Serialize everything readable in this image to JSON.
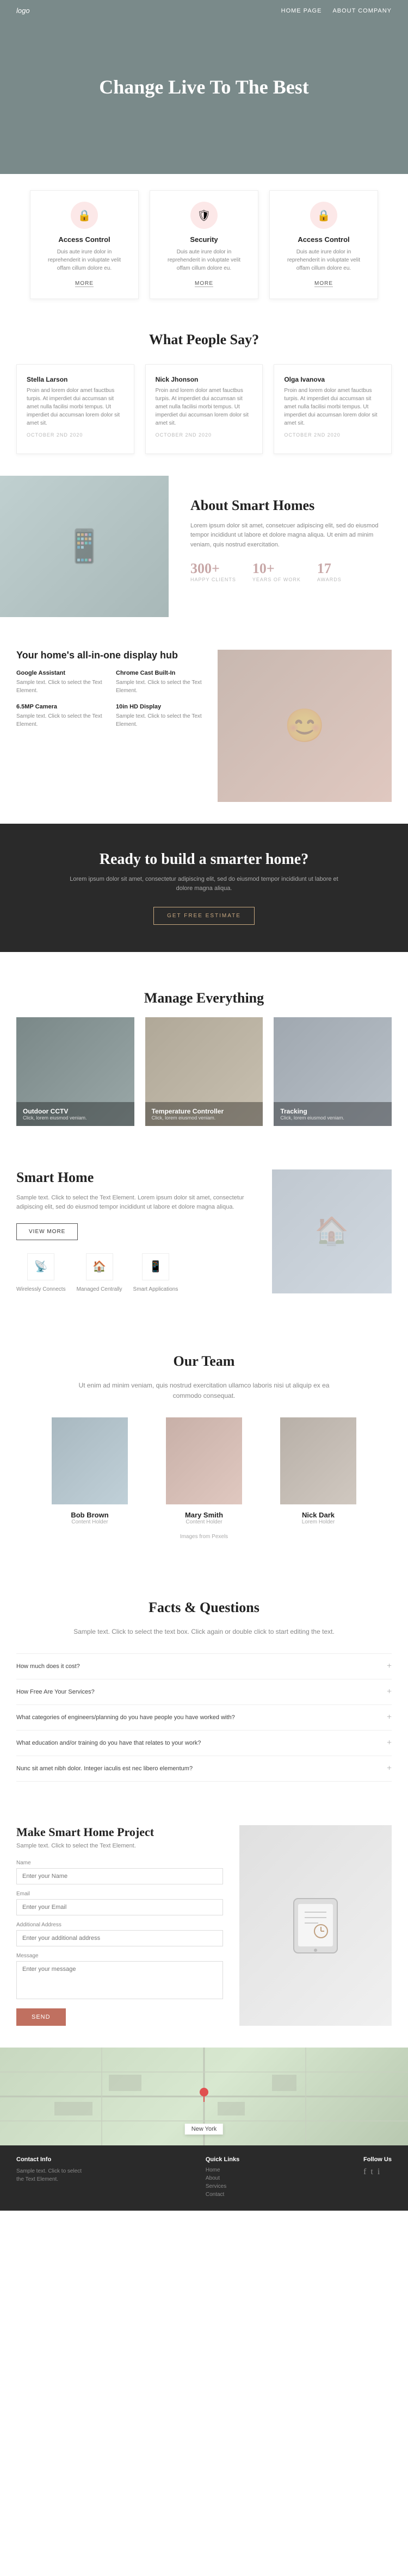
{
  "nav": {
    "logo": "logo",
    "links": [
      {
        "label": "HOME PAGE",
        "href": "#"
      },
      {
        "label": "ABOUT COMPANY",
        "href": "#"
      }
    ]
  },
  "hero": {
    "headline": "Change Live To The Best"
  },
  "features": [
    {
      "icon": "🔒",
      "title": "Access Control",
      "description": "Duis aute irure dolor in reprehenderit in voluptate velit offam cillum dolore eu.",
      "more": "MORE"
    },
    {
      "icon": "🛡",
      "title": "Security",
      "description": "Duis aute irure dolor in reprehenderit in voluptate velit offam cillum dolore eu.",
      "more": "MORE"
    },
    {
      "icon": "🔒",
      "title": "Access Control",
      "description": "Duis aute irure dolor in reprehenderit in voluptate velit offam cillum dolore eu.",
      "more": "MORE"
    }
  ],
  "testimonials_section": {
    "title": "What People Say?"
  },
  "testimonials": [
    {
      "name": "Stella Larson",
      "text": "Proin and lorem dolor amet fauctbus turpis. At imperdiet dui accumsan sit amet nulla facilisi morbi tempus. Ut imperdiet dui accumsan lorem dolor sit amet sit.",
      "date": "OCTOBER 2ND 2020"
    },
    {
      "name": "Nick Jhonson",
      "text": "Proin and lorem dolor amet fauctbus turpis. At imperdiet dui accumsan sit amet nulla facilisi morbi tempus. Ut imperdiet dui accumsan lorem dolor sit amet sit.",
      "date": "OCTOBER 2ND 2020"
    },
    {
      "name": "Olga Ivanova",
      "text": "Proin and lorem dolor amet fauctbus turpis. At imperdiet dui accumsan sit amet nulla facilisi morbi tempus. Ut imperdiet dui accumsan lorem dolor sit amet sit.",
      "date": "OCTOBER 2ND 2020"
    }
  ],
  "about": {
    "title": "About Smart Homes",
    "text": "Lorem ipsum dolor sit amet, consetcuer adipiscing elit, sed do eiusmod tempor incididunt ut labore et dolore magna aliqua. Ut enim ad minim veniam, quis nostrud exercitation.",
    "stats": [
      {
        "number": "300+",
        "label": "HAPPY CLIENTS"
      },
      {
        "number": "10+",
        "label": "YEARS OF WORK"
      },
      {
        "number": "17",
        "label": "AWARDS"
      }
    ]
  },
  "hub": {
    "subtitle": "Your home's all-in-one display hub",
    "items": [
      {
        "title": "Google Assistant",
        "text": "Sample text. Click to select the Text Element."
      },
      {
        "title": "Chrome Cast Built-In",
        "text": "Sample text. Click to select the Text Element."
      },
      {
        "title": "6.5MP Camera",
        "text": "Sample text. Click to select the Text Element."
      },
      {
        "title": "10in HD Display",
        "text": "Sample text. Click to select the Text Element."
      }
    ]
  },
  "cta": {
    "title": "Ready to build a smarter home?",
    "text": "Lorem ipsum dolor sit amet, consectetur adipiscing elit, sed do eiusmod tempor incididunt ut labore et dolore magna aliqua.",
    "button": "GET FREE ESTIMATE"
  },
  "manage": {
    "title": "Manage Everything",
    "cards": [
      {
        "title": "Outdoor CCTV",
        "text": "Click, lorem eiusmod veniam."
      },
      {
        "title": "Temperature Controller",
        "text": "Click, lorem eiusmod veniam."
      },
      {
        "title": "Tracking",
        "text": "Click, lorem eiusmod veniam."
      }
    ]
  },
  "smart_home": {
    "title": "Smart Home",
    "text": "Sample text. Click to select the Text Element. Lorem ipsum dolor sit amet, consectetur adipiscing elit, sed do eiusmod tempor incididunt ut labore et dolore magna aliqua.",
    "button": "VIEW MORE",
    "icons": [
      {
        "icon": "📡",
        "label": "Wirelessly Connects"
      },
      {
        "icon": "🏠",
        "label": "Managed Centrally"
      },
      {
        "icon": "📱",
        "label": "Smart Applications"
      }
    ]
  },
  "team": {
    "title": "Our Team",
    "subtitle": "Ut enim ad minim veniam, quis nostrud exercitation ullamco laboris nisi ut aliquip ex ea commodo consequat.",
    "members": [
      {
        "name": "Bob Brown",
        "role": "Content Holder"
      },
      {
        "name": "Mary Smith",
        "role": "Content Holder"
      },
      {
        "name": "Nick Dark",
        "role": "Lorem Holder"
      }
    ],
    "images_from": "Images from Pexels"
  },
  "facts": {
    "title": "Facts & Questions",
    "subtitle": "Sample text. Click to select the text box. Click again or double click to start editing the text.",
    "items": [
      {
        "question": "How much does it cost?"
      },
      {
        "question": "How Free Are Your Services?"
      },
      {
        "question": "What categories of engineers/planning do you have people you have worked with?"
      },
      {
        "question": "What education and/or training do you have that relates to your work?"
      },
      {
        "question": "Nunc sit amet nibh dolor. Integer iaculis est nec libero elementum?"
      }
    ]
  },
  "project": {
    "title": "Make Smart Home Project",
    "subtitle": "Sample text. Click to select the Text Element.",
    "form": {
      "name_label": "Name",
      "name_placeholder": "Enter your Name",
      "email_label": "Email",
      "email_placeholder": "Enter your Email",
      "phone_label": "Additional Address",
      "phone_placeholder": "Enter your additional address",
      "message_label": "Message",
      "message_placeholder": "Enter your message",
      "submit": "SEND"
    }
  },
  "map": {
    "label": "New York"
  },
  "footer": {
    "col1_title": "Contact Info",
    "col1_text": "Sample text. Click to select\nthe Text Element.",
    "col2_title": "Quick Links",
    "col2_links": [
      "Home",
      "About",
      "Services",
      "Contact"
    ],
    "col3_title": "Follow Us"
  }
}
